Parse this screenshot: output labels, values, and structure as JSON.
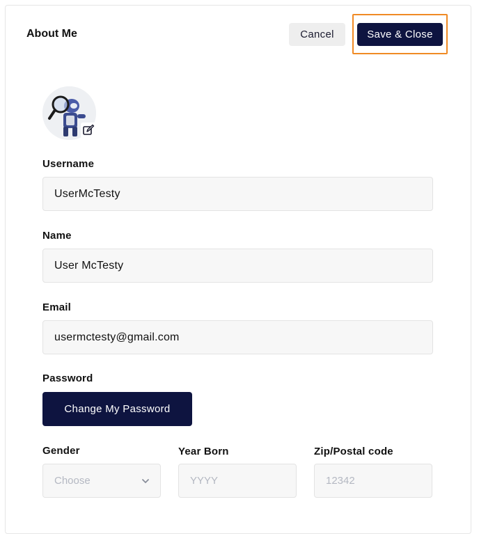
{
  "header": {
    "title": "About Me",
    "cancel_label": "Cancel",
    "save_label": "Save & Close"
  },
  "avatar": {
    "alt": "profile avatar",
    "edit_icon": "edit-icon"
  },
  "fields": {
    "username": {
      "label": "Username",
      "value": "UserMcTesty"
    },
    "name": {
      "label": "Name",
      "value": "User McTesty"
    },
    "email": {
      "label": "Email",
      "value": "usermctesty@gmail.com"
    },
    "password": {
      "label": "Password",
      "button": "Change My Password"
    },
    "gender": {
      "label": "Gender",
      "placeholder": "Choose"
    },
    "year_born": {
      "label": "Year Born",
      "placeholder": "YYYY"
    },
    "zip": {
      "label": "Zip/Postal code",
      "placeholder": "12342"
    }
  },
  "colors": {
    "primary": "#0e1440",
    "highlight": "#f08a24",
    "field_bg": "#f7f7f7",
    "placeholder": "#b4b8c2"
  }
}
